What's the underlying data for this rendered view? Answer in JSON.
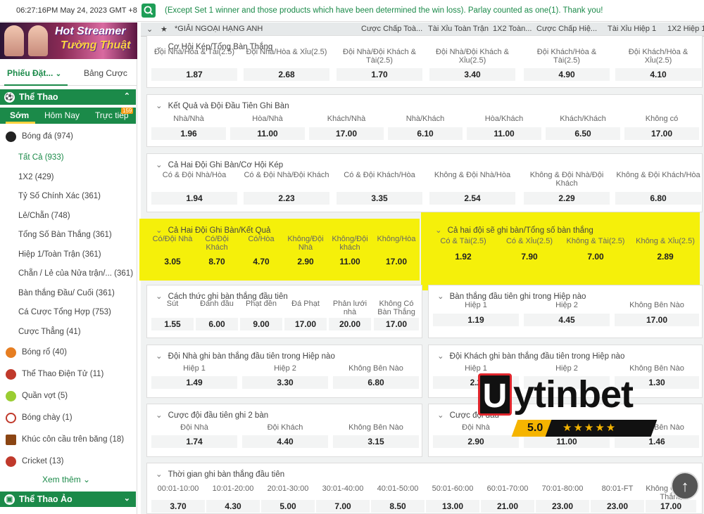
{
  "topbar": {
    "clock": "06:27:16PM May 24, 2023 GMT +8",
    "marquee": "(Except Set 1 winner and those products which have been determined the win loss). Parlay counted as one(1). Thank you!"
  },
  "banner": {
    "line1": "Hot Streamer",
    "line2": "Tường Thuật"
  },
  "sidebar": {
    "tabs": [
      "Phiếu Đặt...",
      "Bảng Cược"
    ],
    "sports_header": "Thể Thao",
    "subtabs": [
      "Sớm",
      "Hôm Nay",
      "Trực tiếp"
    ],
    "live_badge": "159",
    "football": "Bóng đá (974)",
    "football_sub": [
      "Tất Cả (933)",
      "1X2 (429)",
      "Tỷ Số Chính Xác (361)",
      "Lẻ/Chẵn (748)",
      "Tổng Số Bàn Thắng (361)",
      "Hiệp 1/Toàn Trận (361)",
      "Chẵn / Lẻ của Nửa trận/... (361)",
      "Bàn thắng Đầu/ Cuối (361)",
      "Cá Cược Tổng Hợp (753)",
      "Cược Thẳng (41)"
    ],
    "sports": [
      "Bóng rổ (40)",
      "Thể Thao Điện Tử (11)",
      "Quần vợt (5)",
      "Bóng chày (1)",
      "Khúc côn cầu trên băng (18)",
      "Cricket (13)"
    ],
    "see_more": "Xem thêm",
    "virtual_header": "Thể Thao Ảo"
  },
  "header": {
    "league": "*GIẢI NGOẠI HẠNG ANH",
    "cols": [
      "Cược Chấp Toà...",
      "Tài Xỉu Toàn Trận",
      "1X2 Toàn...",
      "Cược Chấp Hiệ...",
      "Tài Xỉu Hiệp 1",
      "1X2 Hiệp 1"
    ]
  },
  "markets": {
    "m1": {
      "title": "Cơ Hội Kép/Tổng Bàn Thắng",
      "labels": [
        "Đội Nhà/Hòa & Tài(2.5)",
        "Đội Nhà/Hòa & Xỉu(2.5)",
        "Đội Nhà/Đội Khách & Tài(2.5)",
        "Đội Nhà/Đội Khách & Xỉu(2.5)",
        "Đội Khách/Hòa & Tài(2.5)",
        "Đội Khách/Hòa & Xỉu(2.5)"
      ],
      "odds": [
        "1.87",
        "2.68",
        "1.70",
        "3.40",
        "4.90",
        "4.10"
      ]
    },
    "m2": {
      "title": "Kết Quả và Đội Đầu Tiên Ghi Bàn",
      "labels": [
        "Nhà/Nhà",
        "Hòa/Nhà",
        "Khách/Nhà",
        "Nhà/Khách",
        "Hòa/Khách",
        "Khách/Khách",
        "Không có"
      ],
      "odds": [
        "1.96",
        "11.00",
        "17.00",
        "6.10",
        "11.00",
        "6.50",
        "17.00"
      ]
    },
    "m3": {
      "title": "Cả Hai Đội Ghi Bàn/Cơ Hội Kép",
      "labels": [
        "Có & Đội Nhà/Hòa",
        "Có & Đội Nhà/Đội Khách",
        "Có & Đội Khách/Hòa",
        "Không & Đội Nhà/Hòa",
        "Không & Đội Nhà/Đội Khách",
        "Không & Đội Khách/Hòa"
      ],
      "odds": [
        "1.94",
        "2.23",
        "3.35",
        "2.54",
        "2.29",
        "6.80"
      ]
    },
    "m4": {
      "title": "Cả Hai Đội Ghi Bàn/Kết Quả",
      "labels": [
        "Có/Đội Nhà",
        "Có/Đội Khách",
        "Có/Hòa",
        "Không/Đội Nhà",
        "Không/Đội khách",
        "Không/Hòa"
      ],
      "odds": [
        "3.05",
        "8.70",
        "4.70",
        "2.90",
        "11.00",
        "17.00"
      ]
    },
    "m5": {
      "title": "Cả hai đội sẽ ghi bàn/Tổng số bàn thắng",
      "labels": [
        "Có & Tài(2.5)",
        "Có & Xỉu(2.5)",
        "Không & Tài(2.5)",
        "Không & Xỉu(2.5)"
      ],
      "odds": [
        "1.92",
        "7.90",
        "7.00",
        "2.89"
      ]
    },
    "m6": {
      "title": "Cách thức ghi bàn thắng đầu tiên",
      "labels": [
        "Sút",
        "Đánh đầu",
        "Phạt đền",
        "Đá Phạt",
        "Phản lưới nhà",
        "Không Có Bàn Thắng"
      ],
      "odds": [
        "1.55",
        "6.00",
        "9.00",
        "17.00",
        "20.00",
        "17.00"
      ]
    },
    "m7": {
      "title": "Bàn thắng đầu tiên ghi trong Hiệp nào",
      "labels": [
        "Hiệp 1",
        "Hiệp 2",
        "Không Bên Nào"
      ],
      "odds": [
        "1.19",
        "4.45",
        "17.00"
      ]
    },
    "m8": {
      "title": "Đội Nhà ghi bàn thắng đầu tiên trong Hiệp nào",
      "labels": [
        "Hiệp 1",
        "Hiệp 2",
        "Không Bên Nào"
      ],
      "odds": [
        "1.49",
        "3.30",
        "6.80"
      ]
    },
    "m9": {
      "title": "Đội Khách ghi bàn thắng đầu tiên trong Hiệp nào",
      "labels": [
        "Hiệp 1",
        "Hiệp 2",
        "Không Bên Nào"
      ],
      "odds": [
        "2.2",
        "",
        "1.30"
      ]
    },
    "m10": {
      "title": "Cược đội đầu tiên ghi 2 bàn",
      "labels": [
        "Đội Nhà",
        "Đội Khách",
        "Không Bên Nào"
      ],
      "odds": [
        "1.74",
        "4.40",
        "3.15"
      ]
    },
    "m11": {
      "title": "Cược đội đầu",
      "labels": [
        "Đội Nhà",
        "",
        "Không Bên Nào"
      ],
      "odds": [
        "2.90",
        "11.00",
        "1.46"
      ]
    },
    "m12": {
      "title": "Thời gian ghi bàn thắng đầu tiên",
      "labels": [
        "00:01-10:00",
        "10:01-20:00",
        "20:01-30:00",
        "30:01-40:00",
        "40:01-50:00",
        "50:01-60:00",
        "60:01-70:00",
        "70:01-80:00",
        "80:01-FT",
        "Không Có Bàn Thắng"
      ],
      "odds": [
        "3.70",
        "4.30",
        "5.00",
        "7.00",
        "8.50",
        "13.00",
        "21.00",
        "23.00",
        "23.00",
        "17.00"
      ]
    }
  },
  "watermark": {
    "u": "U",
    "name": "ytinbet",
    "score": "5.0",
    "stars": "★★★★★"
  },
  "colors": {
    "brand_green": "#1b8a49",
    "highlight": "#f5f00a",
    "odds_bg": "#f3f4f4"
  }
}
